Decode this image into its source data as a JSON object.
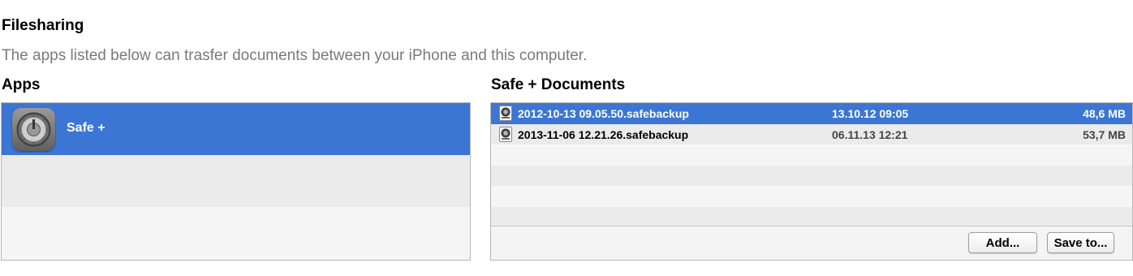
{
  "page": {
    "title": "Filesharing",
    "subtitle": "The apps listed below can trasfer documents between your iPhone and this computer."
  },
  "apps": {
    "heading": "Apps",
    "items": [
      {
        "name": "Safe +",
        "icon": "safe-icon",
        "selected": true
      }
    ]
  },
  "documents": {
    "heading": "Safe + Documents",
    "files": [
      {
        "name": "2012-10-13 09.05.50.safebackup",
        "date": "13.10.12 09:05",
        "size": "48,6 MB",
        "selected": true
      },
      {
        "name": "2013-11-06 12.21.26.safebackup",
        "date": "06.11.13 12:21",
        "size": "53,7 MB",
        "selected": false
      }
    ],
    "add_label": "Add...",
    "save_label": "Save to..."
  },
  "colors": {
    "selection": "#3b76d4",
    "row_alt": "#ebebeb",
    "row_plain": "#f5f5f5",
    "subtitle": "#7a7a7a"
  }
}
